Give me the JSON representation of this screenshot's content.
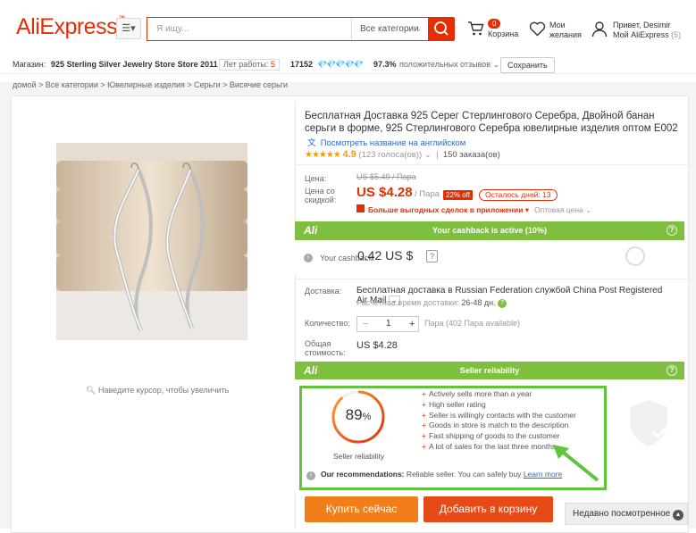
{
  "colors": {
    "brand": "#e62e04",
    "green_bar": "#7fbf3f",
    "highlight": "#62c33c",
    "link": "#2d69c8",
    "buy": "#f27e1a",
    "add_to_cart": "#e64a16"
  },
  "header": {
    "logo": "AliExpress",
    "logo_tm": "™",
    "search_placeholder": "Я ищу...",
    "category": "Все категории",
    "cart_count": "0",
    "cart_label": "Корзина",
    "wishlist_label_1": "Мои",
    "wishlist_label_2": "желания",
    "greeting": "Привет, Desimir",
    "my_ali": "Мой AliExpress",
    "my_ali_count": "(5)"
  },
  "store": {
    "label": "Магазин:",
    "name": "925 Sterling Silver Jewelry Store Store 2011",
    "years_label": "Лет работы:",
    "years": "5",
    "score": "17152",
    "gems": "💎💎💎💎💎",
    "positive": "97.3%",
    "positive_label": "положительных отзывов",
    "save": "Сохранить"
  },
  "breadcrumb": "домой > Все категории > Ювелирные изделия > Серьги > Висячие серьги",
  "product": {
    "title": "Бесплатная Доставка 925 Серег Стерлингового Серебра, Двойной банан серьги в форме, 925 Стерлингового Серебра ювелирные изделия оптом E002",
    "translate": "Посмотреть название на английском",
    "rating": "4.9",
    "votes": "(123 голоса(ов))",
    "orders": "150 заказа(ов)",
    "price_label": "Цена:",
    "old_price": "US $5.49 / Пара",
    "discount_label_1": "Цена со",
    "discount_label_2": "скидкой:",
    "new_price": "US $4.28",
    "per_unit": "/ Пара",
    "off": "22% off",
    "days_left": "Осталось дней: 13",
    "app_deals": "Больше выгодных сделок в приложении",
    "wholesale": "Оптовая цена",
    "zoom_hint": "Наведите курсор, чтобы увеличить"
  },
  "cashback": {
    "bar": "Your cashback is active (10%)",
    "label": "Your cashback:",
    "value": "0.42 US $"
  },
  "shipping": {
    "label": "Доставка:",
    "text": "Бесплатная доставка в Russian Federation службой China Post Registered Air Mail",
    "time_label": "Расчётное время доставки:",
    "time": "26-48 дн.",
    "qty_label": "Количество:",
    "qty": "1",
    "qty_note": "Пара (402 Пара available)",
    "total_label_1": "Общая",
    "total_label_2": "стоимость:",
    "total": "US $4.28"
  },
  "reliability": {
    "bar": "Seller reliability",
    "percent": 89,
    "percent_text": "89",
    "percent_sign": "%",
    "label": "Seller reliability",
    "items": [
      "Actively sells more than a year",
      "High seller rating",
      "Seller is willingly contacts with the customer",
      "Goods in store is match to the description",
      "Fast shipping of goods to the customer",
      "A lot of sales for the last three months"
    ],
    "rec_label": "Our recommendations:",
    "rec_text": "Reliable seller. You can safely buy",
    "rec_link": "Learn more"
  },
  "actions": {
    "buy": "Купить сейчас",
    "add": "Добавить в корзину",
    "recent": "Недавно посмотренное"
  }
}
